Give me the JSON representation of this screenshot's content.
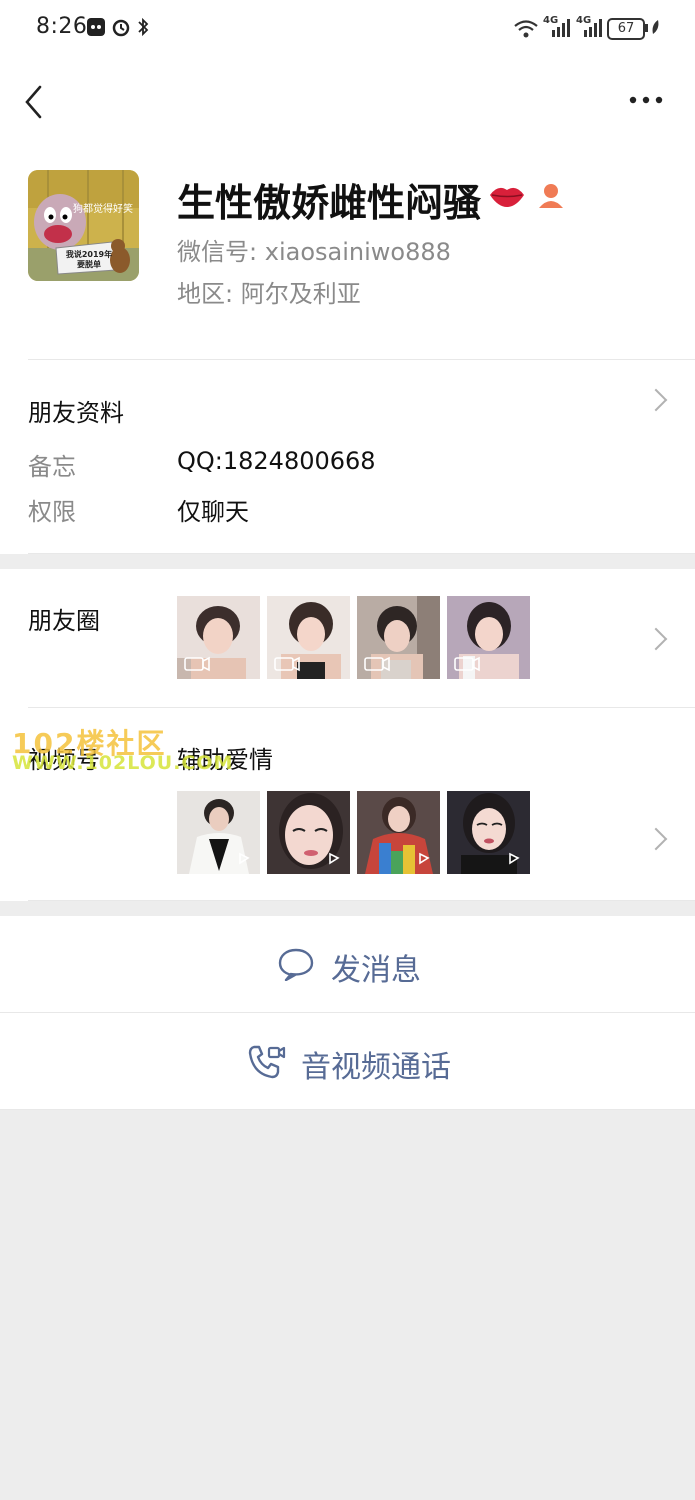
{
  "status_bar": {
    "time": "8:26",
    "network1": "4G",
    "network2": "4G",
    "battery": "67"
  },
  "nav": {
    "back_icon": "chevron-left-icon",
    "more_icon": "more-dots-icon"
  },
  "profile": {
    "avatar_caption_top": "狗都觉得好笑",
    "avatar_caption_card": "我说2019年要脱单",
    "name": "生性傲娇雌性闷骚",
    "wechat_id_label": "微信号:",
    "wechat_id": "xiaosainiwo888",
    "region_label": "地区:",
    "region": "阿尔及利亚"
  },
  "friend_info": {
    "title": "朋友资料",
    "remark_label": "备忘",
    "remark_value": "QQ:1824800668",
    "permission_label": "权限",
    "permission_value": "仅聊天"
  },
  "moments": {
    "title": "朋友圈"
  },
  "channels": {
    "title": "视频号",
    "name": "辅助爱情"
  },
  "watermark": {
    "line1": "102楼社区",
    "line2": "WWW.102LOU.COM"
  },
  "actions": {
    "message_label": "发消息",
    "call_label": "音视频通话"
  },
  "colors": {
    "link": "#576b95",
    "background": "#ededed"
  }
}
